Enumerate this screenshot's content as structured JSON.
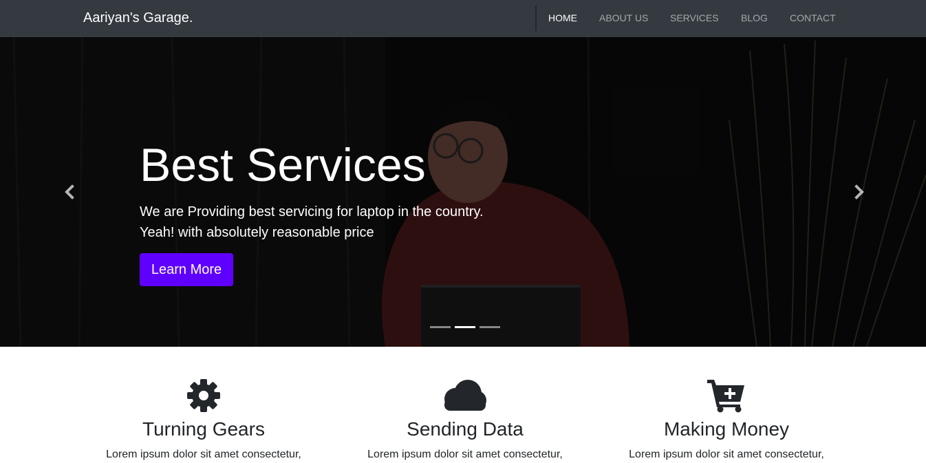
{
  "navbar": {
    "brand": "Aariyan's Garage.",
    "links": [
      {
        "label": "HOME",
        "active": true
      },
      {
        "label": "ABOUT US",
        "active": false
      },
      {
        "label": "SERVICES",
        "active": false
      },
      {
        "label": "BLOG",
        "active": false
      },
      {
        "label": "CONTACT",
        "active": false
      }
    ],
    "bg_color": "#343a40"
  },
  "hero": {
    "title": "Best Services",
    "text_line1": "We are Providing best servicing for laptop in the country.",
    "text_line2": "Yeah! with absolutely reasonable price",
    "button_label": "Learn More",
    "button_color": "#5f00ff",
    "prev_icon": "chevron-left-icon",
    "next_icon": "chevron-right-icon",
    "slide_count": 3,
    "active_slide": 2
  },
  "features": [
    {
      "icon": "gear-icon",
      "title": "Turning Gears",
      "text": "Lorem ipsum dolor sit amet consectetur,"
    },
    {
      "icon": "cloud-icon",
      "title": "Sending Data",
      "text": "Lorem ipsum dolor sit amet consectetur,"
    },
    {
      "icon": "cart-plus-icon",
      "title": "Making Money",
      "text": "Lorem ipsum dolor sit amet consectetur,"
    }
  ]
}
